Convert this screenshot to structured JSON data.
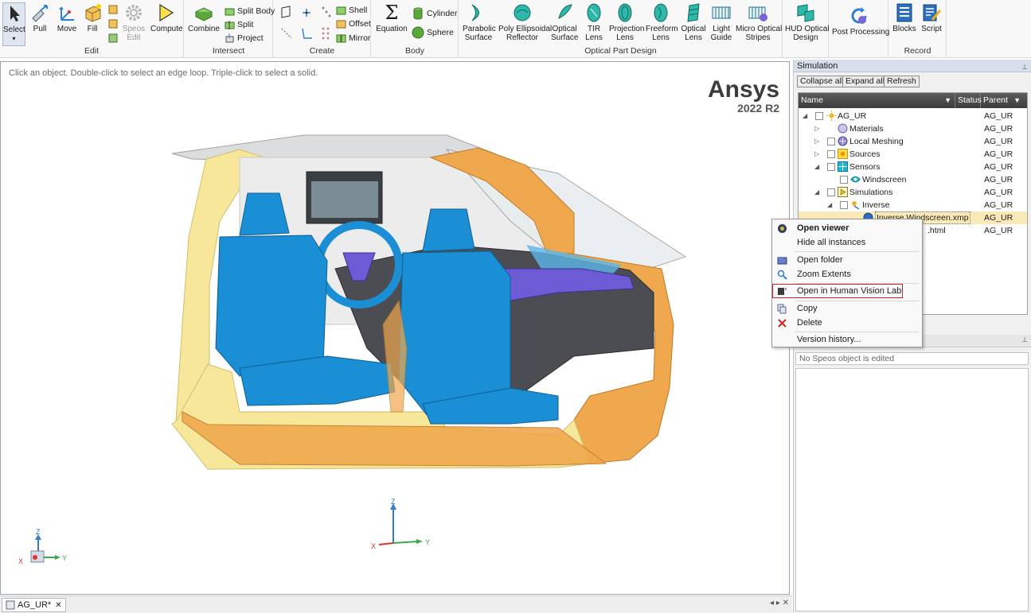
{
  "ribbon": {
    "groups": {
      "edit": "Edit",
      "intersect": "Intersect",
      "create": "Create",
      "body": "Body",
      "optical": "Optical Part Design",
      "record": "Record"
    },
    "buttons": {
      "select": "Select",
      "pull": "Pull",
      "move": "Move",
      "fill": "Fill",
      "speos_edit": [
        "Speos",
        "Edit"
      ],
      "compute": "Compute",
      "combine": "Combine",
      "split_body": "Split Body",
      "split": "Split",
      "project": "Project",
      "shell": "Shell",
      "offset": "Offset",
      "mirror": "Mirror",
      "equation": "Equation",
      "cylinder": "Cylinder",
      "sphere": "Sphere",
      "parabolic_surface": [
        "Parabolic",
        "Surface"
      ],
      "poly_ellipsoidal": [
        "Poly Ellipsoidal",
        "Reflector"
      ],
      "optical_surface": [
        "Optical",
        "Surface"
      ],
      "tir_lens": [
        "TIR",
        "Lens"
      ],
      "projection_lens": [
        "Projection",
        "Lens"
      ],
      "freeform_lens": [
        "Freeform",
        "Lens"
      ],
      "optical_lens": [
        "Optical",
        "Lens"
      ],
      "light_guide": [
        "Light",
        "Guide"
      ],
      "micro_optical": [
        "Micro Optical",
        "Stripes"
      ],
      "hud_optical": [
        "HUD Optical",
        "Design"
      ],
      "post_processing": "Post Processing",
      "blocks": "Blocks",
      "script": "Script"
    }
  },
  "viewport": {
    "hint": "Click an object. Double-click to select an edge loop. Triple-click to select a solid.",
    "brand": "Ansys",
    "version": "2022 R2",
    "axis_labels": {
      "z": "Z",
      "x": "X",
      "y": "Y"
    }
  },
  "doc_tab": {
    "label": "AG_UR*",
    "close": "✕",
    "nav": "◂ ▸ ✕"
  },
  "simulation_panel": {
    "title": "Simulation",
    "pin": "📌",
    "buttons": {
      "collapse": "Collapse all",
      "expand": "Expand all",
      "refresh": "Refresh"
    },
    "columns": {
      "name": "Name",
      "status": "Status",
      "parent": "Parent"
    },
    "rows": [
      {
        "name": "AG_UR",
        "parent": "AG_UR",
        "expander": "◢"
      },
      {
        "name": "Materials",
        "parent": "AG_UR",
        "expander": "▷"
      },
      {
        "name": "Local Meshing",
        "parent": "AG_UR",
        "expander": "▷"
      },
      {
        "name": "Sources",
        "parent": "AG_UR",
        "expander": "▷"
      },
      {
        "name": "Sensors",
        "parent": "AG_UR",
        "expander": "◢"
      },
      {
        "name": "Windscreen",
        "parent": "AG_UR",
        "expander": ""
      },
      {
        "name": "Simulations",
        "parent": "AG_UR",
        "expander": "◢"
      },
      {
        "name": "Inverse",
        "parent": "AG_UR",
        "expander": "◢"
      },
      {
        "name": "Inverse.Windscreen.xmp",
        "parent": "AG_UR",
        "expander": ""
      },
      {
        "name": ".html",
        "parent": "AG_UR",
        "expander": ""
      }
    ],
    "second_panel_pin": "📌",
    "no_object": "No Speos object is edited"
  },
  "context_menu": {
    "items": [
      {
        "label": "Open viewer",
        "icon": "viewer-icon"
      },
      {
        "label": "Hide all instances",
        "icon": ""
      },
      {
        "label": "Open folder",
        "icon": "folder-icon"
      },
      {
        "label": "Zoom Extents",
        "icon": "magnifier-icon"
      },
      {
        "label": "Open in Human Vision Lab",
        "icon": "hvl-icon"
      },
      {
        "label": "Copy",
        "icon": "copy-icon"
      },
      {
        "label": "Delete",
        "icon": "delete-icon"
      },
      {
        "label": "Version history...",
        "icon": ""
      }
    ]
  },
  "colors": {
    "seat_blue": "#1a8fd6",
    "frame_yellow": "#f6e79b",
    "frame_orange": "#f0a84e",
    "dash_purple": "#6c5bd4",
    "highlight_red": "#d0212b",
    "selection_row": "#fce9b8"
  }
}
